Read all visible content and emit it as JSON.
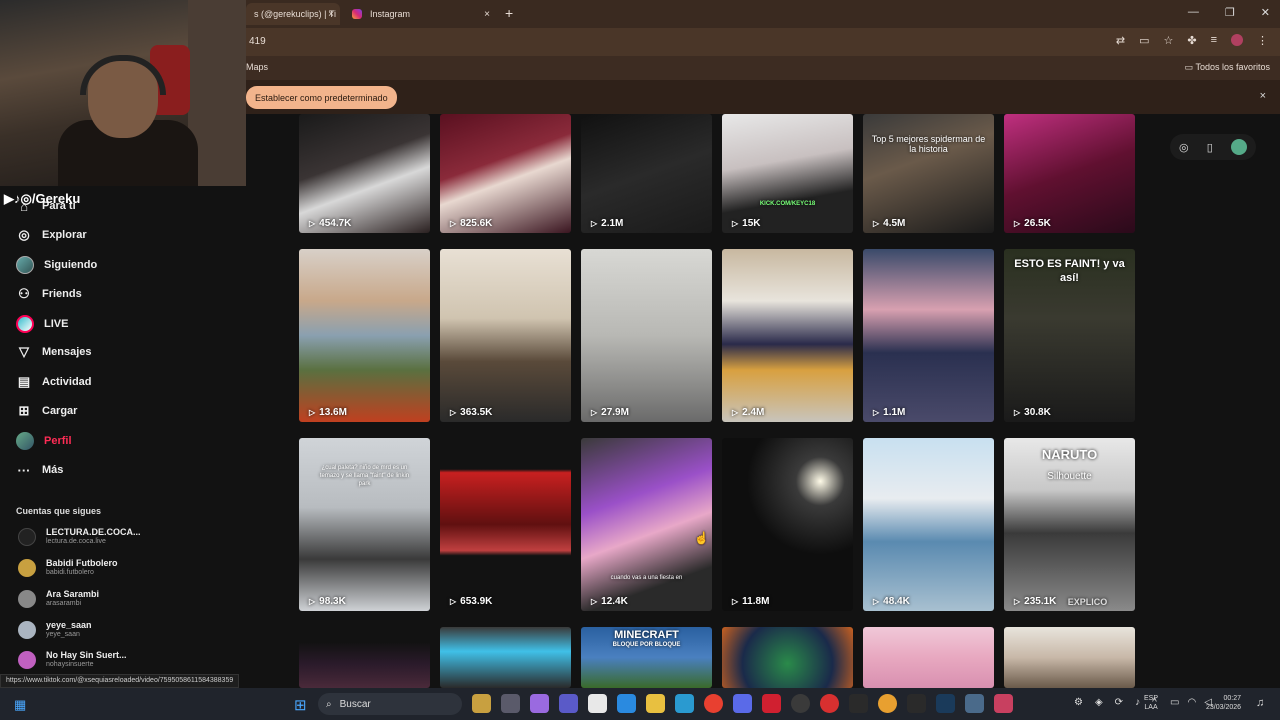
{
  "browser": {
    "tabs": [
      {
        "label": "s (@gerekuclips) | Ti",
        "close": "×"
      },
      {
        "label": "Instagram",
        "close": "×"
      }
    ],
    "new_tab": "+",
    "address": "419",
    "bookmark_maps": "Maps",
    "bookmark_favs": "Todos los favoritos",
    "default_prompt": "Establecer como predeterminado",
    "info_close": "×",
    "window_min": "—",
    "window_max": "❐",
    "window_close": "✕"
  },
  "overlay": {
    "socials": "▶♪◎/Gereku"
  },
  "sidebar": {
    "items": [
      {
        "label": "Para ti",
        "icon": "home-icon"
      },
      {
        "label": "Explorar",
        "icon": "compass-icon"
      },
      {
        "label": "Siguiendo",
        "icon": "following-avatar-icon"
      },
      {
        "label": "Friends",
        "icon": "friends-icon"
      },
      {
        "label": "LIVE",
        "icon": "live-icon"
      },
      {
        "label": "Mensajes",
        "icon": "messages-icon"
      },
      {
        "label": "Actividad",
        "icon": "activity-icon"
      },
      {
        "label": "Cargar",
        "icon": "upload-icon"
      },
      {
        "label": "Perfil",
        "icon": "profile-avatar-icon"
      },
      {
        "label": "Más",
        "icon": "more-icon"
      }
    ],
    "following_header": "Cuentas que sigues",
    "following": [
      {
        "name": "LECTURA.DE.COCA...",
        "handle": "lectura.de.coca.live",
        "color": "#1a1a1a"
      },
      {
        "name": "Babidi Futbolero",
        "handle": "babidi.futbolero",
        "color": "#c8a040"
      },
      {
        "name": "Ara Sarambi",
        "handle": "arasarambi",
        "color": "#888888"
      },
      {
        "name": "yeye_saan",
        "handle": "yeye_saan",
        "color": "#aab4c0"
      },
      {
        "name": "No Hay Sin Suert...",
        "handle": "nohaysinsuerte",
        "color": "#c060c0"
      }
    ]
  },
  "status_url": "https://www.tiktok.com/@xsequiasreloaded/video/7595058611584388359",
  "videos": {
    "row1": [
      {
        "views": "454.7K"
      },
      {
        "views": "825.6K"
      },
      {
        "views": "2.1M"
      },
      {
        "views": "15K",
        "caption": "KICK.COM/KEYC18"
      },
      {
        "views": "4.5M",
        "caption": "Top 5 mejores spiderman de la historia"
      },
      {
        "views": "26.5K"
      }
    ],
    "row2": [
      {
        "views": "13.6M"
      },
      {
        "views": "363.5K"
      },
      {
        "views": "27.9M"
      },
      {
        "views": "2.4M"
      },
      {
        "views": "1.1M"
      },
      {
        "views": "30.8K",
        "caption": "ESTO ES FAINT! y va así!"
      }
    ],
    "row3": [
      {
        "views": "98.3K",
        "caption": "¿cual paleta? niño de mrd es un temazo y se llama \"faint\" de linkin park"
      },
      {
        "views": "653.9K"
      },
      {
        "views": "12.4K",
        "caption": "cuando vas a una fiesta en"
      },
      {
        "views": "11.8M"
      },
      {
        "views": "48.4K"
      },
      {
        "views": "235.1K",
        "caption": "NARUTO",
        "caption2": "Silhouette",
        "caption3": "EXPLICO"
      }
    ],
    "row4": [
      {
        "views": ""
      },
      {
        "views": ""
      },
      {
        "views": "",
        "caption": "MINECRAFT",
        "caption2": "BLOQUE POR BLOQUE"
      },
      {
        "views": ""
      },
      {
        "views": ""
      },
      {
        "views": ""
      }
    ]
  },
  "taskbar": {
    "search": "Buscar",
    "lang1": "ESP",
    "lang2": "LAA",
    "time": "00:27",
    "date": "23/03/2026"
  }
}
